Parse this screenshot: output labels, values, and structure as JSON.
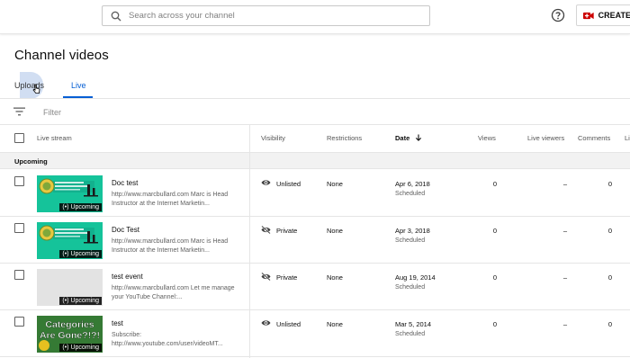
{
  "search": {
    "placeholder": "Search across your channel"
  },
  "header": {
    "create_label": "CREATE"
  },
  "page": {
    "title": "Channel videos"
  },
  "tabs": {
    "uploads": "Uploads",
    "live": "Live"
  },
  "filter": {
    "label": "Filter"
  },
  "columns": {
    "live_stream": "Live stream",
    "visibility": "Visibility",
    "restrictions": "Restrictions",
    "date": "Date",
    "views": "Views",
    "live_viewers": "Live viewers",
    "comments": "Comments",
    "likes_partial": "Li"
  },
  "section": {
    "label": "Upcoming"
  },
  "rows": [
    {
      "thumb": "green",
      "badge": "Upcoming",
      "title": "Doc test",
      "description": "http://www.marcbullard.com Marc is Head Instructor at the Internet Marketin...",
      "visibility": "Unlisted",
      "restrictions": "None",
      "date": "Apr 6, 2018",
      "status": "Scheduled",
      "views": "0",
      "live_viewers": "–",
      "comments": "0"
    },
    {
      "thumb": "green",
      "badge": "Upcoming",
      "title": "Doc Test",
      "description": "http://www.marcbullard.com Marc is Head Instructor at the Internet Marketin...",
      "visibility": "Private",
      "restrictions": "None",
      "date": "Apr 3, 2018",
      "status": "Scheduled",
      "views": "0",
      "live_viewers": "–",
      "comments": "0"
    },
    {
      "thumb": "grey",
      "badge": "Upcoming",
      "title": "test event",
      "description": "http://www.marcbullard.com Let me manage your YouTube Channel:...",
      "visibility": "Private",
      "restrictions": "None",
      "date": "Aug 19, 2014",
      "status": "Scheduled",
      "views": "0",
      "live_viewers": "–",
      "comments": "0"
    },
    {
      "thumb": "categories",
      "thumb_text": "Categories Are Gone?!?!",
      "badge": "Upcoming",
      "title": "test",
      "description": "Subscribe: http://www.youtube.com/user/videoMT...",
      "visibility": "Unlisted",
      "restrictions": "None",
      "date": "Mar 5, 2014",
      "status": "Scheduled",
      "views": "0",
      "live_viewers": "–",
      "comments": "0"
    }
  ],
  "colors": {
    "accent_blue": "#065fd4",
    "create_red": "#cc0000",
    "thumb_green": "#15c39a"
  }
}
